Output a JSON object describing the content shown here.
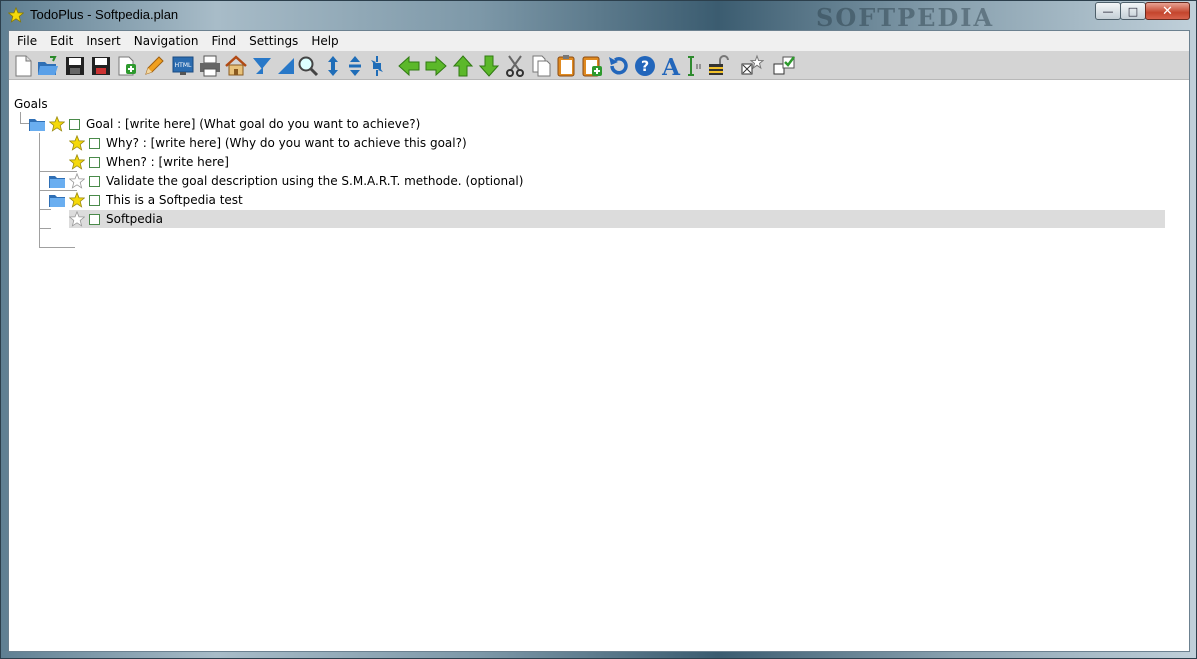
{
  "window": {
    "title": "TodoPlus - Softpedia.plan",
    "watermark": "SOFTPEDIA",
    "controls": {
      "minimize": "—",
      "maximize": "□",
      "close": "✕"
    }
  },
  "menu": [
    "File",
    "Edit",
    "Insert",
    "Navigation",
    "Find",
    "Settings",
    "Help"
  ],
  "toolbar": {
    "buttons": [
      "new-file-icon",
      "open-folder-icon",
      "save-icon",
      "save-as-icon",
      "add-file-icon",
      "pencil-icon",
      "html-export-icon",
      "print-icon",
      "home-icon",
      "collapse-icon",
      "expand-icon",
      "search-icon",
      "move-vertical-icon",
      "move-up-down-icon",
      "move-all-icon",
      "arrow-left-icon",
      "arrow-right-icon",
      "arrow-up-icon",
      "arrow-down-icon",
      "cut-icon",
      "copy-icon",
      "paste-icon",
      "paste-special-icon",
      "undo-icon",
      "help-icon",
      "font-icon",
      "text-cursor-icon",
      "unlock-icon",
      "checkbox-star-icon",
      "checked-box-icon"
    ],
    "html_label": "HTML"
  },
  "tree": {
    "root_label": "Goals",
    "nodes": [
      {
        "label": "Goal : [write here] (What goal do you want to achieve?)",
        "level": 1,
        "folder": true,
        "star": "gold",
        "selected": false
      },
      {
        "label": "Why? : [write here] (Why do you want to achieve this goal?)",
        "level": 2,
        "folder": false,
        "star": "gold",
        "selected": false
      },
      {
        "label": "When? : [write here]",
        "level": 2,
        "folder": false,
        "star": "gold",
        "selected": false
      },
      {
        "label": "Validate the goal description using the S.M.A.R.T. methode. (optional)",
        "level": 2,
        "folder": true,
        "star": "empty",
        "selected": false
      },
      {
        "label": "This is a Softpedia test",
        "level": 2,
        "folder": true,
        "star": "gold",
        "selected": false
      },
      {
        "label": "Softpedia",
        "level": 2,
        "folder": false,
        "star": "empty",
        "selected": true
      }
    ]
  },
  "colors": {
    "star_gold": "#f5d90a",
    "folder_blue": "#3a7fd0",
    "checkbox_green": "#4a8a4a",
    "selection": "#dcdcdc",
    "toolbar_bg": "#d4d4d4"
  }
}
